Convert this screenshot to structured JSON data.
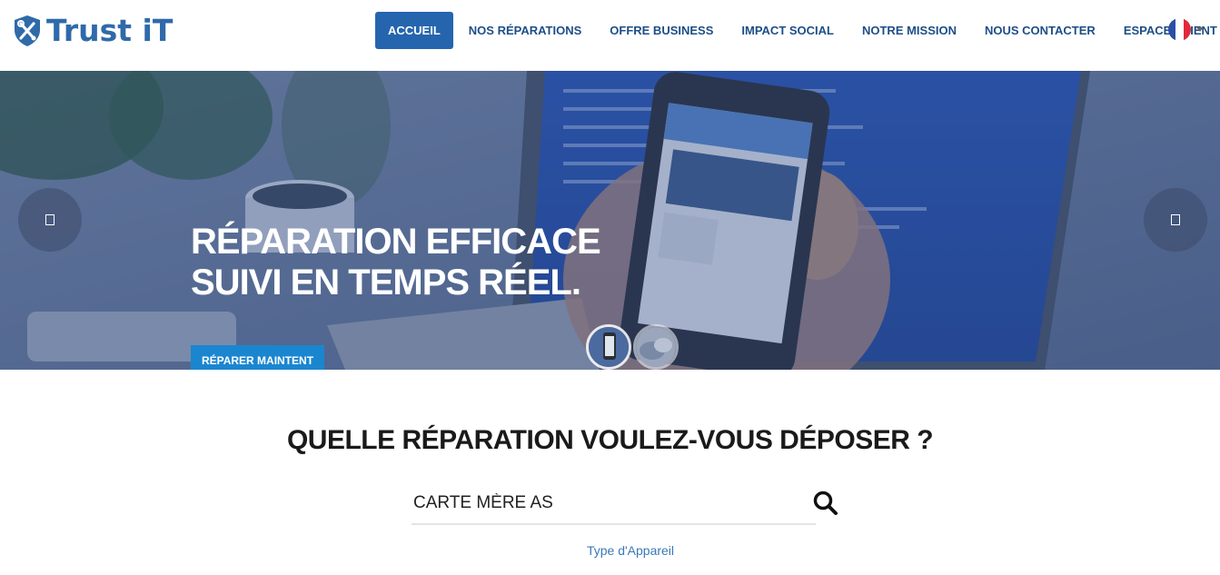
{
  "brand": {
    "name": "Trust iT",
    "color": "#2f6aa9",
    "icon": "shield-tools-icon"
  },
  "nav": {
    "items": [
      {
        "label": "ACCUEIL",
        "active": true
      },
      {
        "label": "NOS RÉPARATIONS",
        "active": false
      },
      {
        "label": "OFFRE BUSINESS",
        "active": false
      },
      {
        "label": "IMPACT SOCIAL",
        "active": false
      },
      {
        "label": "NOTRE MISSION",
        "active": false
      },
      {
        "label": "NOUS CONTACTER",
        "active": false
      },
      {
        "label": "ESPACE CLIENT",
        "active": false
      }
    ],
    "active_color": "#2565ad",
    "language": {
      "icon": "flag-france-icon",
      "dropdown_icon": "caret-down-icon"
    }
  },
  "hero": {
    "headline_line1": "RÉPARATION EFFICACE",
    "headline_line2": "SUIVI EN TEMPS RÉEL.",
    "cta_label": "RÉPARER MAINTENT",
    "cta_color": "#1b86d0",
    "prev_icon": "prev-arrow-icon",
    "next_icon": "next-arrow-icon",
    "slides": [
      {
        "thumb": "slide-thumb-phone",
        "active": true
      },
      {
        "thumb": "slide-thumb-hands",
        "active": false
      }
    ]
  },
  "repair": {
    "question": "QUELLE RÉPARATION VOULEZ-VOUS DÉPOSER ?",
    "search_value": "CARTE MÈRE AS",
    "search_icon": "search-icon",
    "device_type_link": "Type d'Appareil"
  }
}
